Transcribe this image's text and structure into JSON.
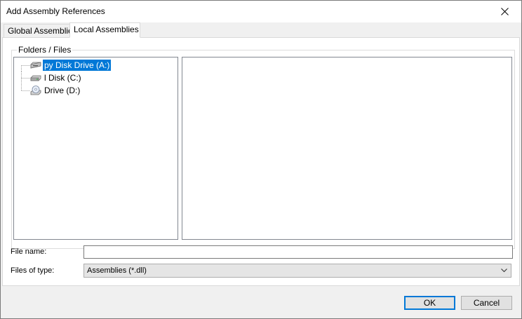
{
  "window": {
    "title": "Add Assembly References"
  },
  "tabs": [
    {
      "label": "Global Assemblies",
      "selected": false
    },
    {
      "label": "Local Assemblies",
      "selected": true
    }
  ],
  "browser": {
    "group_label": "Folders / Files",
    "tree_items": [
      {
        "label": "py Disk Drive (A:)",
        "icon": "floppy-drive-icon",
        "selected": true
      },
      {
        "label": "l Disk (C:)",
        "icon": "hard-disk-icon",
        "selected": false
      },
      {
        "label": "Drive (D:)",
        "icon": "cd-drive-icon",
        "selected": false
      }
    ]
  },
  "form": {
    "filename_label": "File name:",
    "filename_value": "",
    "filetype_label": "Files of type:",
    "filetype_value": "Assemblies (*.dll)"
  },
  "buttons": {
    "ok_label": "OK",
    "cancel_label": "Cancel"
  },
  "colors": {
    "selection": "#0078d7",
    "default_button_border": "#0078d7"
  }
}
